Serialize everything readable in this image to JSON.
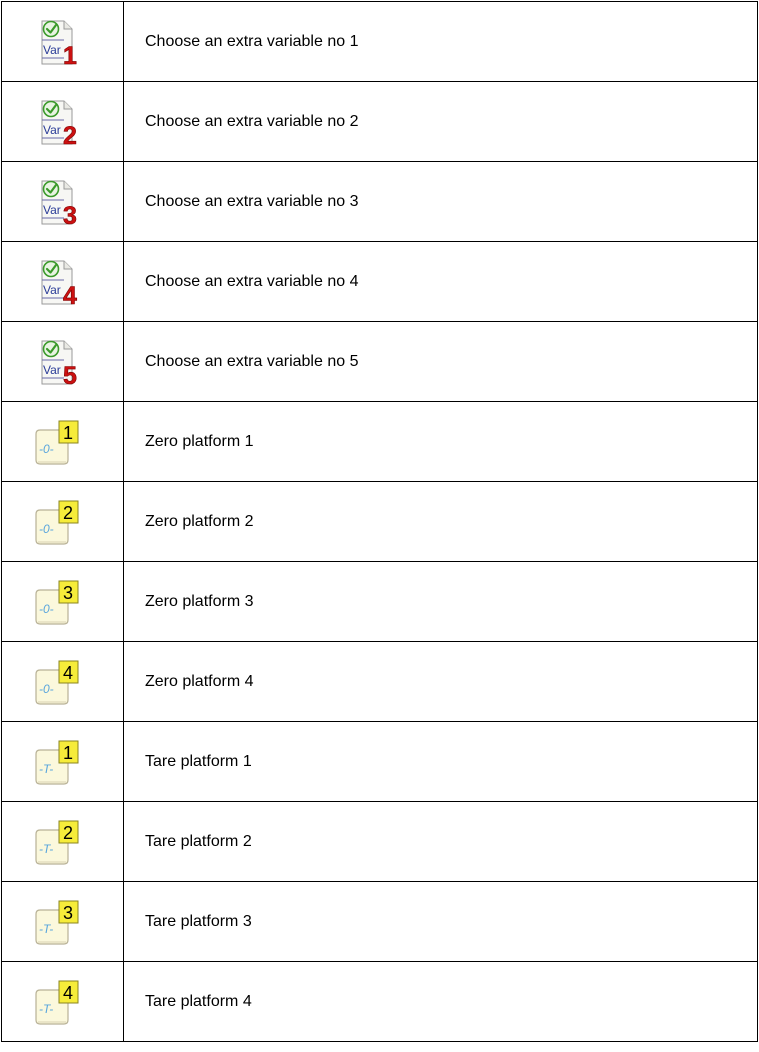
{
  "rows": [
    {
      "kind": "var",
      "num": "1",
      "label": "Choose an extra variable no 1"
    },
    {
      "kind": "var",
      "num": "2",
      "label": "Choose an extra variable no 2"
    },
    {
      "kind": "var",
      "num": "3",
      "label": "Choose an extra variable no 3"
    },
    {
      "kind": "var",
      "num": "4",
      "label": "Choose an extra variable no 4"
    },
    {
      "kind": "var",
      "num": "5",
      "label": "Choose an extra variable no 5"
    },
    {
      "kind": "zero",
      "num": "1",
      "label": "Zero platform 1"
    },
    {
      "kind": "zero",
      "num": "2",
      "label": "Zero platform 2"
    },
    {
      "kind": "zero",
      "num": "3",
      "label": "Zero platform 3"
    },
    {
      "kind": "zero",
      "num": "4",
      "label": "Zero platform 4"
    },
    {
      "kind": "tare",
      "num": "1",
      "label": "Tare platform 1"
    },
    {
      "kind": "tare",
      "num": "2",
      "label": "Tare platform 2"
    },
    {
      "kind": "tare",
      "num": "3",
      "label": "Tare platform 3"
    },
    {
      "kind": "tare",
      "num": "4",
      "label": "Tare platform 4"
    }
  ],
  "icons": {
    "var_text": "Var",
    "zero_symbol": "-0-",
    "tare_symbol": "-T-"
  },
  "colors": {
    "var_number": "#cc1111",
    "check_green": "#3a9a2a",
    "badge_yellow": "#f6ec3a",
    "symbol_blue": "#5aa6dd"
  }
}
